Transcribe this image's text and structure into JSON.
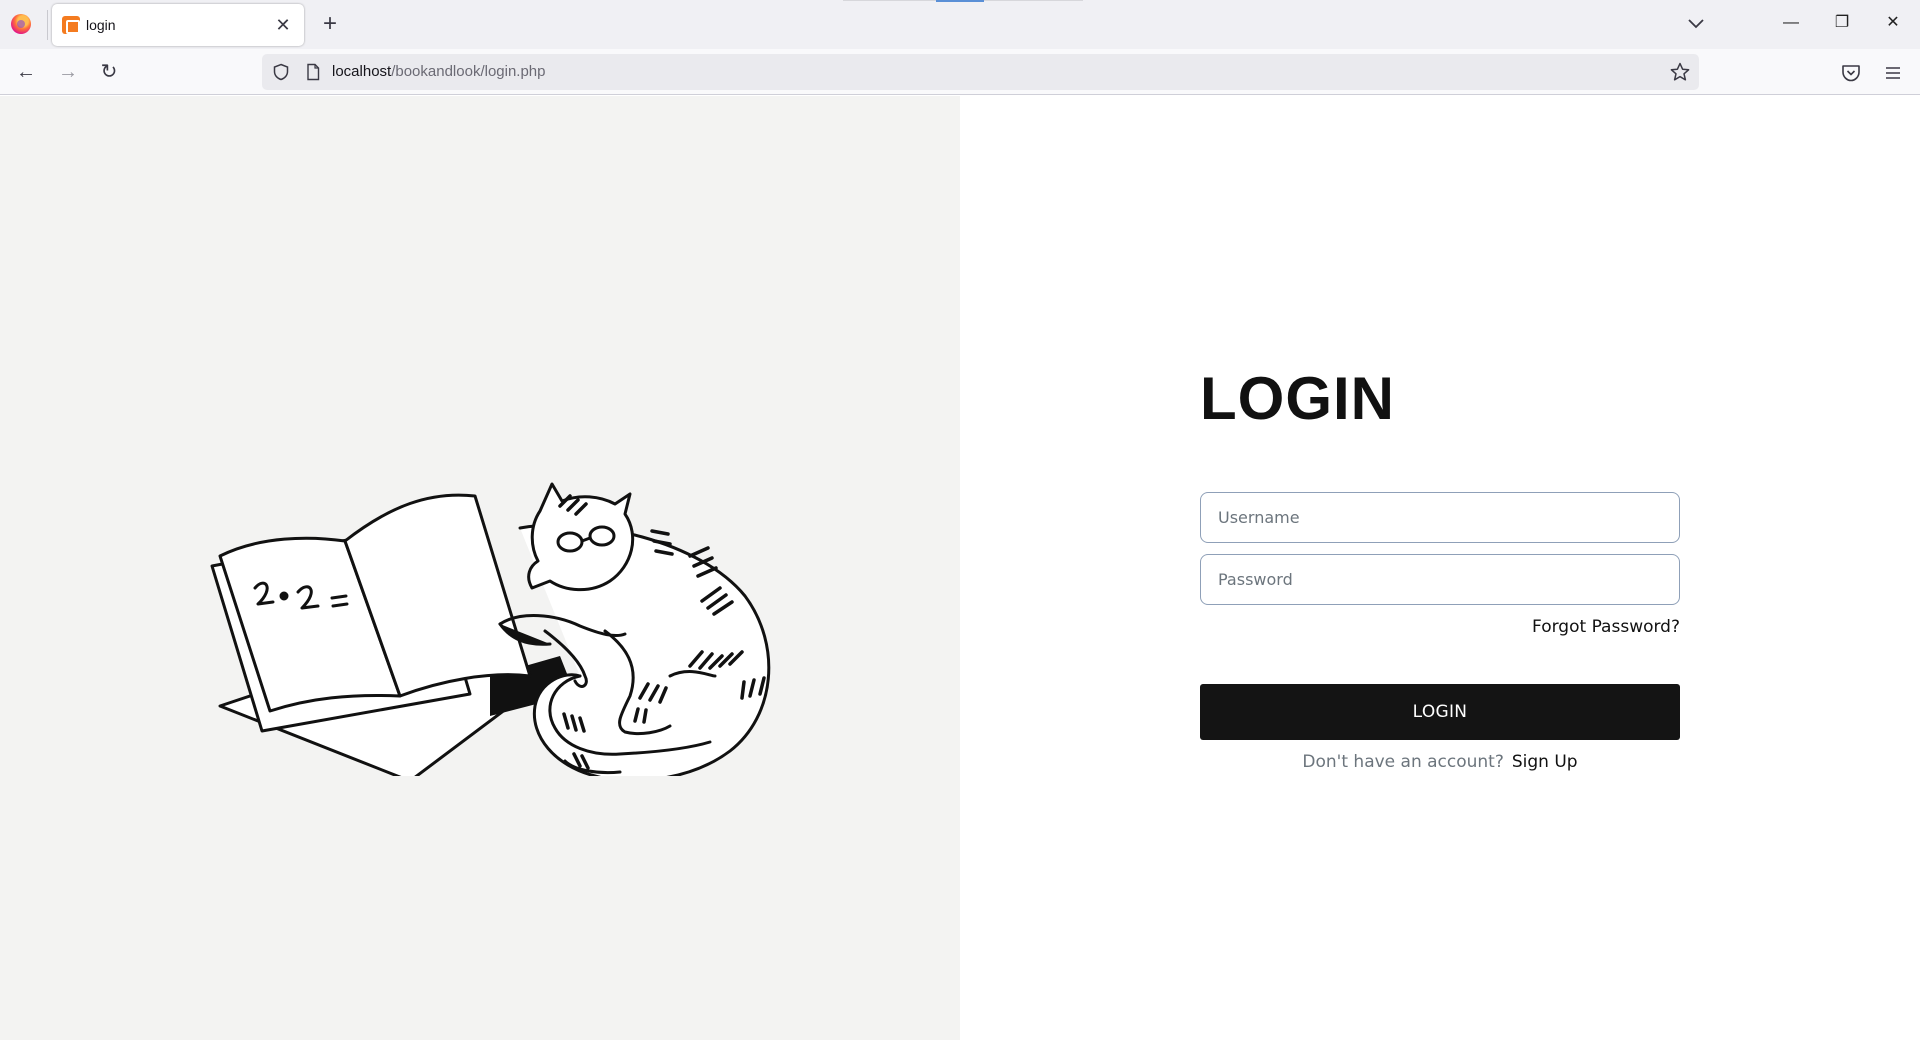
{
  "browser": {
    "tab_title": "login",
    "url_host": "localhost",
    "url_path": "/bookandlook/login.php",
    "icons": {
      "firefox": "firefox-logo-icon",
      "favicon": "xampp-favicon-icon",
      "tab_close": "close-icon",
      "new_tab": "plus-icon",
      "list_tabs": "chevron-down-icon",
      "back": "arrow-left-icon",
      "forward": "arrow-right-icon",
      "reload": "reload-icon",
      "shield": "shield-icon",
      "page": "page-icon",
      "bookmark": "star-icon",
      "pocket": "pocket-icon",
      "menu": "hamburger-menu-icon",
      "minimize": "minimize-icon",
      "maximize": "restore-icon",
      "close": "close-window-icon"
    },
    "glyphs": {
      "tab_close": "✕",
      "new_tab": "+",
      "back": "←",
      "forward": "→",
      "reload": "↻",
      "minimize": "—",
      "maximize": "❐",
      "close": "✕"
    }
  },
  "page": {
    "illustration": "cat-reading-book-illustration",
    "title": "LOGIN",
    "username_placeholder": "Username",
    "password_placeholder": "Password",
    "forgot_password": "Forgot Password?",
    "login_button": "LOGIN",
    "no_account_text": "Don't have an account?",
    "signup_link": "Sign Up"
  },
  "colors": {
    "left_pane_bg": "#f3f3f2",
    "button_bg": "#141414",
    "input_border": "#8fa0b8",
    "muted_text": "#6c757d"
  }
}
